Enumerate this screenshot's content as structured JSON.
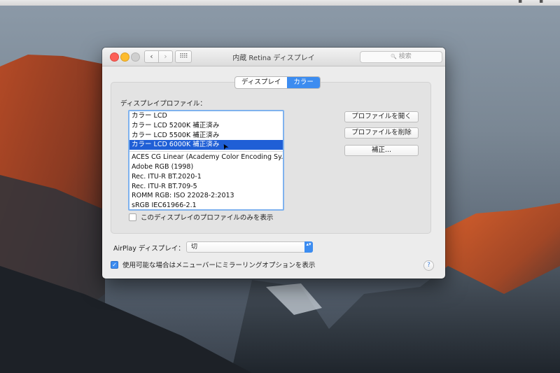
{
  "window": {
    "title": "内蔵 Retina ディスプレイ",
    "search_placeholder": "検索"
  },
  "icons": {
    "back": "‹",
    "forward": "›",
    "grid": "⠿⠿",
    "search": "🔍",
    "help": "?",
    "checkmark": "✓",
    "select_arrows": "▴▾",
    "cursor": "➤"
  },
  "tabs": [
    {
      "label": "ディスプレイ",
      "active": false
    },
    {
      "label": "カラー",
      "active": true
    }
  ],
  "profile_section": {
    "label": "ディスプレイプロファイル：",
    "items": [
      "カラー LCD",
      "カラー LCD 5200K 補正済み",
      "カラー LCD 5500K 補正済み",
      "カラー LCD 6000K 補正済み",
      "ACES CG Linear (Academy Color Encoding Sy...",
      "Adobe RGB (1998)",
      "Rec. ITU-R BT.2020-1",
      "Rec. ITU-R BT.709-5",
      "ROMM RGB: ISO 22028-2:2013",
      "sRGB IEC61966-2.1"
    ],
    "selected_index": 3,
    "open_button": "プロファイルを開く",
    "delete_button": "プロファイルを削除",
    "calibrate_button": "補正...",
    "only_this_display_label": "このディスプレイのプロファイルのみを表示",
    "only_this_display_checked": false
  },
  "airplay": {
    "label": "AirPlay ディスプレイ：",
    "value": "切"
  },
  "mirroring": {
    "label": "使用可能な場合はメニューバーにミラーリングオプションを表示",
    "checked": true
  },
  "colors": {
    "accent": "#3c8cf0",
    "selection": "#1f5fd6",
    "close": "#fc5f57",
    "minimize": "#fdbc2e"
  }
}
